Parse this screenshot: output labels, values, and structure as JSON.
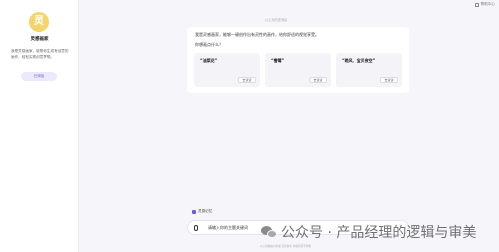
{
  "sidebar": {
    "avatar_char": "灵",
    "agent_name": "灵感画家",
    "agent_desc": "我是灵感画家，能帮你生成有创意的画作，轻松实现创意梦想。",
    "added_label": "已添加"
  },
  "topbar": {
    "help_label": "帮助中心"
  },
  "chat": {
    "day_tag": "以上为历史消息",
    "intro": "我是灵感画家，能够一键创作出有灵性的画作，给你舒适的视觉享受。",
    "ask": "你想画点什么？",
    "suggestions": [
      {
        "title": "“油菜花”",
        "button": "去试试"
      },
      {
        "title": "“雪莓”",
        "button": "去试试"
      },
      {
        "title": "“晚风、宝贝夜空”",
        "button": "去试试"
      }
    ]
  },
  "composer": {
    "memory_label": "灵感记忆",
    "placeholder": "请输入你的主题关键词"
  },
  "footer": {
    "text": "以上内容由AI生成 仅供参考 内容可能不准确"
  },
  "watermark": {
    "text": "公众号 · 产品经理的逻辑与审美"
  },
  "colors": {
    "accent": "#6a5fd6",
    "avatar": "#f3d56b"
  }
}
